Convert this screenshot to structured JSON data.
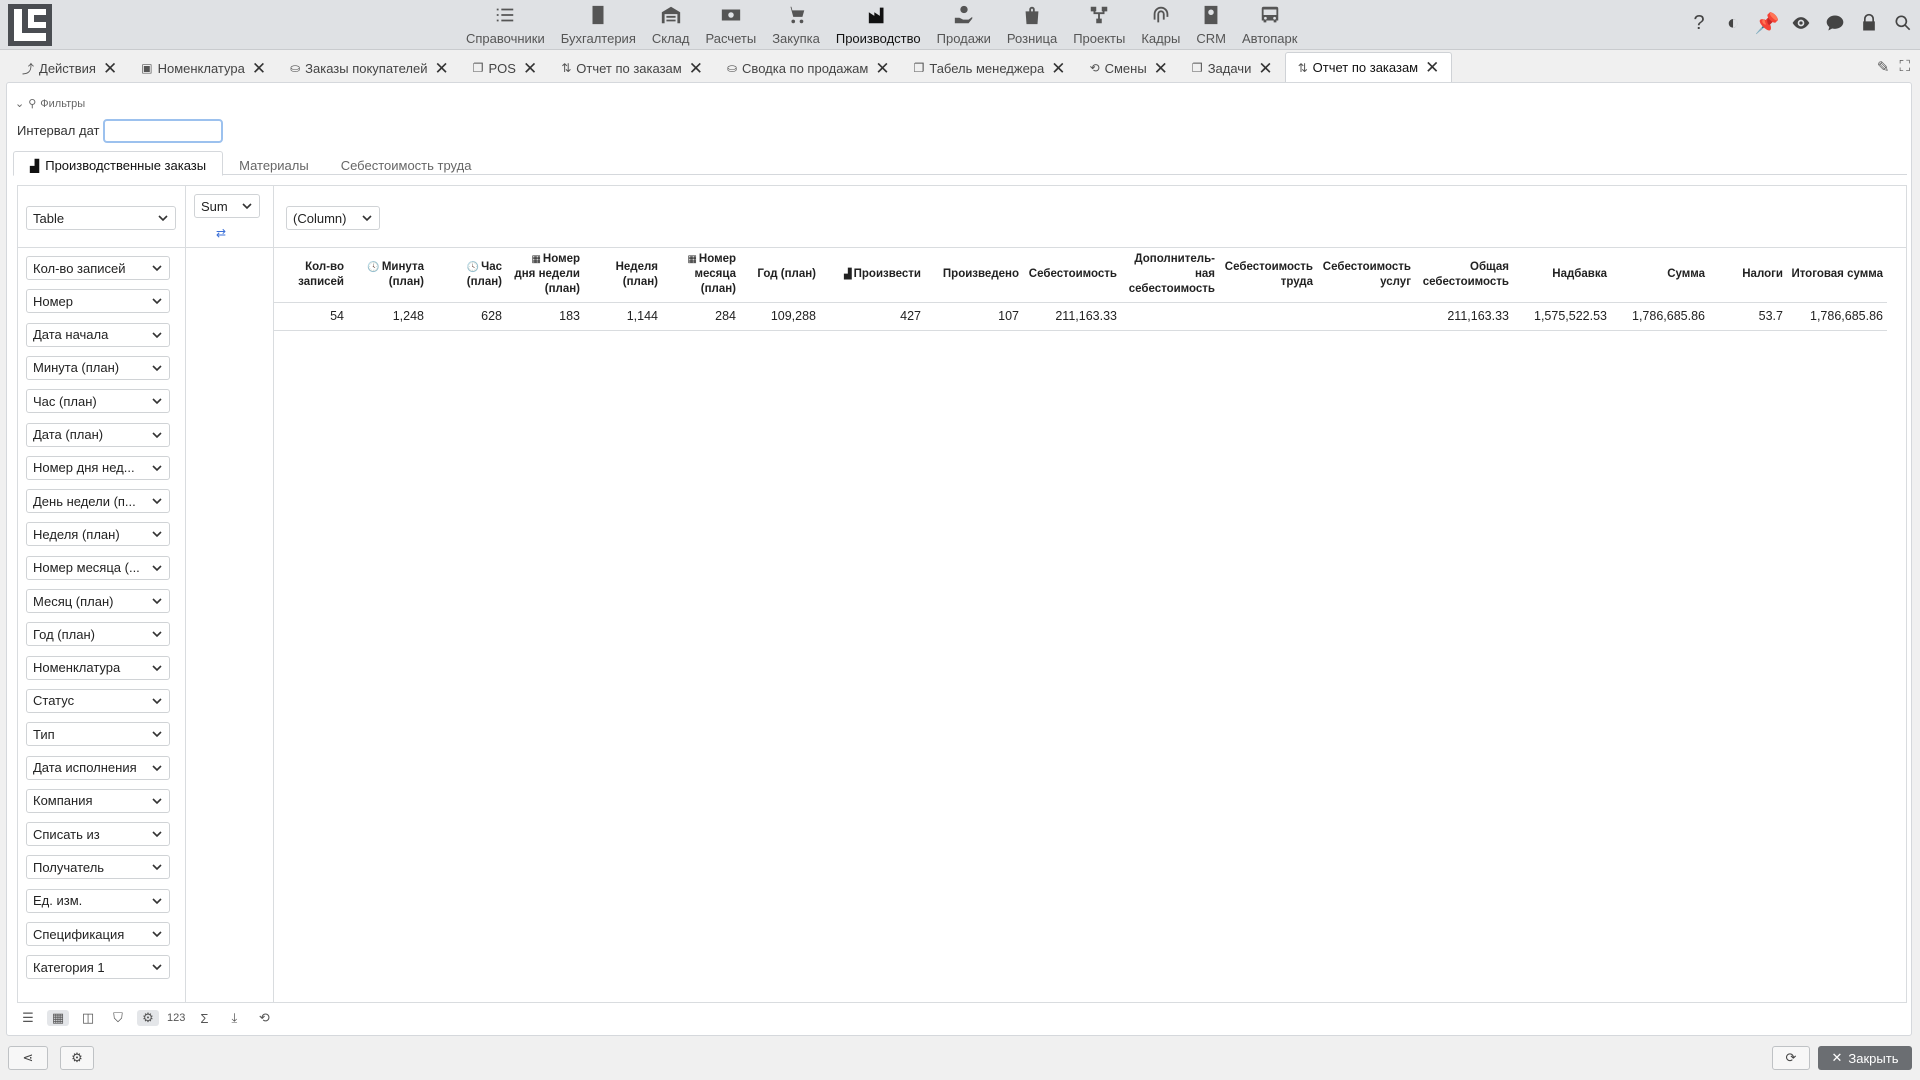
{
  "nav": [
    {
      "label": "Справочники",
      "icon": "list-check-icon"
    },
    {
      "label": "Бухгалтерия",
      "icon": "ledger-icon"
    },
    {
      "label": "Склад",
      "icon": "warehouse-icon"
    },
    {
      "label": "Расчеты",
      "icon": "money-icon"
    },
    {
      "label": "Закупка",
      "icon": "cart-icon"
    },
    {
      "label": "Производство",
      "icon": "factory-icon",
      "active": true
    },
    {
      "label": "Продажи",
      "icon": "hand-money-icon"
    },
    {
      "label": "Розница",
      "icon": "bag-icon"
    },
    {
      "label": "Проекты",
      "icon": "network-icon"
    },
    {
      "label": "Кадры",
      "icon": "fingerprint-icon"
    },
    {
      "label": "CRM",
      "icon": "contact-card-icon"
    },
    {
      "label": "Автопарк",
      "icon": "bus-icon"
    }
  ],
  "tabs": [
    {
      "label": "Действия",
      "icon": "chart-line-icon"
    },
    {
      "label": "Номенклатура",
      "icon": "box-icon"
    },
    {
      "label": "Заказы покупателей",
      "icon": "hand-money-icon"
    },
    {
      "label": "POS",
      "icon": "copy-icon"
    },
    {
      "label": "Отчет по заказам",
      "icon": "sort-icon"
    },
    {
      "label": "Сводка по продажам",
      "icon": "hand-money-icon"
    },
    {
      "label": "Табель менеджера",
      "icon": "copy-icon"
    },
    {
      "label": "Смены",
      "icon": "refresh-icon"
    },
    {
      "label": "Задачи",
      "icon": "copy-icon"
    },
    {
      "label": "Отчет по заказам",
      "icon": "sort-icon",
      "active": true
    }
  ],
  "filters": {
    "title": "Фильтры",
    "date_label": "Интервал дат",
    "date_value": ""
  },
  "subtabs": [
    {
      "label": "Производственные заказы",
      "active": true
    },
    {
      "label": "Материалы"
    },
    {
      "label": "Себестоимость труда"
    }
  ],
  "pivot": {
    "renderer": "Table",
    "aggregator": "Sum",
    "column_field": "(Column)",
    "row_fields": [
      "Кол-во записей",
      "Номер",
      "Дата начала",
      "Минута (план)",
      "Час (план)",
      "Дата (план)",
      "Номер дня нед...",
      "День недели (п...",
      "Неделя (план)",
      "Номер месяца (...",
      "Месяц (план)",
      "Год (план)",
      "Номенклатура",
      "Статус",
      "Тип",
      "Дата исполнения",
      "Компания",
      "Списать из",
      "Получатель",
      "Ед. изм.",
      "Спецификация",
      "Категория 1"
    ],
    "headers": [
      {
        "label": "Кол-во записей",
        "icon": "",
        "width": 74
      },
      {
        "label": "Минута (план)",
        "icon": "clock-icon",
        "width": 80
      },
      {
        "label": "Час (план)",
        "icon": "clock-icon",
        "width": 78
      },
      {
        "label": "Номер дня недели (план)",
        "icon": "calendar-icon",
        "width": 78
      },
      {
        "label": "Неделя (план)",
        "icon": "",
        "width": 78
      },
      {
        "label": "Номер месяца (план)",
        "icon": "calendar-icon",
        "width": 78
      },
      {
        "label": "Год (план)",
        "icon": "",
        "width": 80
      },
      {
        "label": "Произвести",
        "icon": "factory-icon",
        "width": 105
      },
      {
        "label": "Произведено",
        "icon": "",
        "width": 98
      },
      {
        "label": "Себестоимость",
        "icon": "",
        "width": 98
      },
      {
        "label": "Дополнитель-ная себестоимость",
        "icon": "",
        "width": 98
      },
      {
        "label": "Себестоимость труда",
        "icon": "",
        "width": 98
      },
      {
        "label": "Себестоимость услуг",
        "icon": "",
        "width": 98
      },
      {
        "label": "Общая себестоимость",
        "icon": "",
        "width": 98
      },
      {
        "label": "Надбавка",
        "icon": "",
        "width": 98
      },
      {
        "label": "Сумма",
        "icon": "",
        "width": 98
      },
      {
        "label": "Налоги",
        "icon": "",
        "width": 78
      },
      {
        "label": "Итоговая сумма",
        "icon": "",
        "width": 100
      }
    ],
    "row": [
      "54",
      "1,248",
      "628",
      "183",
      "1,144",
      "284",
      "109,288",
      "427",
      "107",
      "211,163.33",
      "",
      "",
      "",
      "211,163.33",
      "1,575,522.53",
      "1,786,685.86",
      "53.7",
      "1,786,685.86"
    ]
  },
  "toolbar_label": "123",
  "footer": {
    "close_label": "Закрыть"
  }
}
